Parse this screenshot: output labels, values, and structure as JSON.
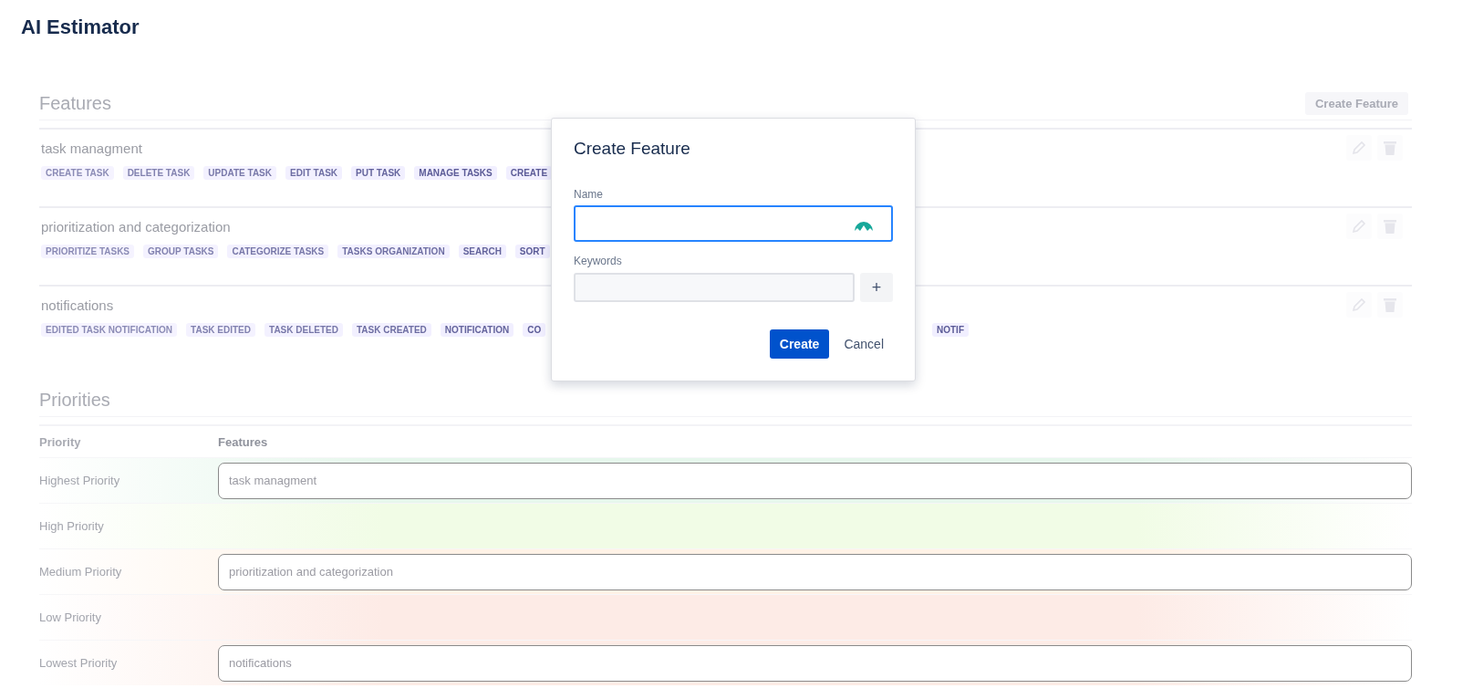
{
  "app_title": "AI Estimator",
  "features": {
    "heading": "Features",
    "create_button": "Create Feature",
    "items": [
      {
        "name": "task managment",
        "keywords": [
          "CREATE TASK",
          "DELETE TASK",
          "UPDATE TASK",
          "EDIT TASK",
          "PUT TASK",
          "MANAGE TASKS",
          "CREATE"
        ]
      },
      {
        "name": "prioritization and categorization",
        "keywords": [
          "PRIORITIZE TASKS",
          "GROUP TASKS",
          "CATEGORIZE TASKS",
          "TASKS ORGANIZATION",
          "SEARCH",
          "SORT"
        ]
      },
      {
        "name": "notifications",
        "keywords": [
          "EDITED TASK NOTIFICATION",
          "TASK EDITED",
          "TASK DELETED",
          "TASK CREATED",
          "NOTIFICATION",
          "CO"
        ],
        "keywords_right": [
          "NOTIF"
        ]
      }
    ]
  },
  "priorities": {
    "heading": "Priorities",
    "columns": [
      "Priority",
      "Features"
    ],
    "rows": [
      {
        "label": "Highest Priority",
        "feature": "task managment",
        "color": "#e6f7ec"
      },
      {
        "label": "High Priority",
        "feature": null,
        "color": "#f1fce6"
      },
      {
        "label": "Medium Priority",
        "feature": "prioritization and categorization",
        "color": "#fff2e6"
      },
      {
        "label": "Low Priority",
        "feature": null,
        "color": "#fdebe6"
      },
      {
        "label": "Lowest Priority",
        "feature": "notifications",
        "color": "#fdece6"
      }
    ]
  },
  "dialog": {
    "title": "Create Feature",
    "name_label": "Name",
    "keywords_label": "Keywords",
    "add_button": "+",
    "create_button": "Create",
    "cancel_button": "Cancel"
  }
}
